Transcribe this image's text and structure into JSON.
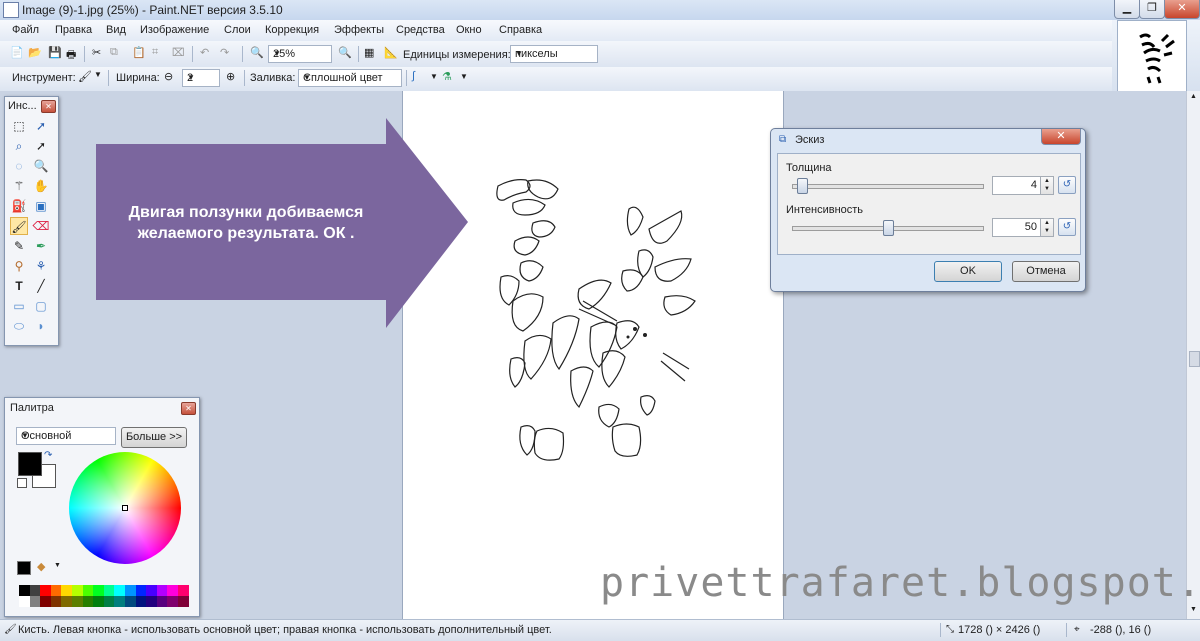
{
  "window": {
    "title": "Image (9)-1.jpg (25%) - Paint.NET версия 3.5.10",
    "controls": [
      "minimize-icon",
      "restore-icon",
      "close-icon"
    ]
  },
  "menu": [
    "Файл",
    "Правка",
    "Вид",
    "Изображение",
    "Слои",
    "Коррекция",
    "Эффекты",
    "Средства",
    "Окно",
    "Справка"
  ],
  "toolbar1": {
    "zoom_value": "25%",
    "units_label": "Единицы измерения:",
    "units_value": "пикселы"
  },
  "toolbar2": {
    "tool_label": "Инструмент:",
    "width_label": "Ширина:",
    "width_value": "2",
    "fill_label": "Заливка:",
    "fill_value": "Сплошной цвет"
  },
  "tools_panel": {
    "title": "Инс..."
  },
  "palette_panel": {
    "title": "Палитра",
    "mode_value": "Основной",
    "more_button": "Больше >>",
    "primary_color": "#000000",
    "secondary_color": "#ffffff",
    "swatches": [
      "#000000",
      "#404040",
      "#ff0000",
      "#ff6a00",
      "#ffd800",
      "#b6ff00",
      "#4cff00",
      "#00ff21",
      "#00ff90",
      "#00ffff",
      "#0094ff",
      "#0026ff",
      "#4800ff",
      "#b200ff",
      "#ff00dc",
      "#ff006e",
      "#ffffff",
      "#808080",
      "#7f0000",
      "#7f3300",
      "#7f6a00",
      "#5b7f00",
      "#267f00",
      "#007f0e",
      "#007f46",
      "#007f7f",
      "#004a7f",
      "#00137f",
      "#21007f",
      "#57007f",
      "#7f006e",
      "#7f0037"
    ]
  },
  "annotation": {
    "text_line1": "Двигая ползунки добиваемся",
    "text_line2": "желаемого результата. ОК .",
    "arrow_color": "#7b669e"
  },
  "dialog": {
    "title": "Эскиз",
    "thickness_label": "Толщина",
    "thickness_value": "4",
    "thickness_level": 0.03,
    "intensity_label": "Интенсивность",
    "intensity_value": "50",
    "intensity_level": 0.5,
    "ok_button": "OK",
    "cancel_button": "Отмена"
  },
  "statusbar": {
    "hint": "Кисть. Левая кнопка - использовать основной цвет; правая кнопка - использовать дополнительный цвет.",
    "image_size": "1728 () × 2426 ()",
    "cursor_pos": "-288 (), 16 ()"
  },
  "watermark": "privettrafaret.blogspot.ru"
}
